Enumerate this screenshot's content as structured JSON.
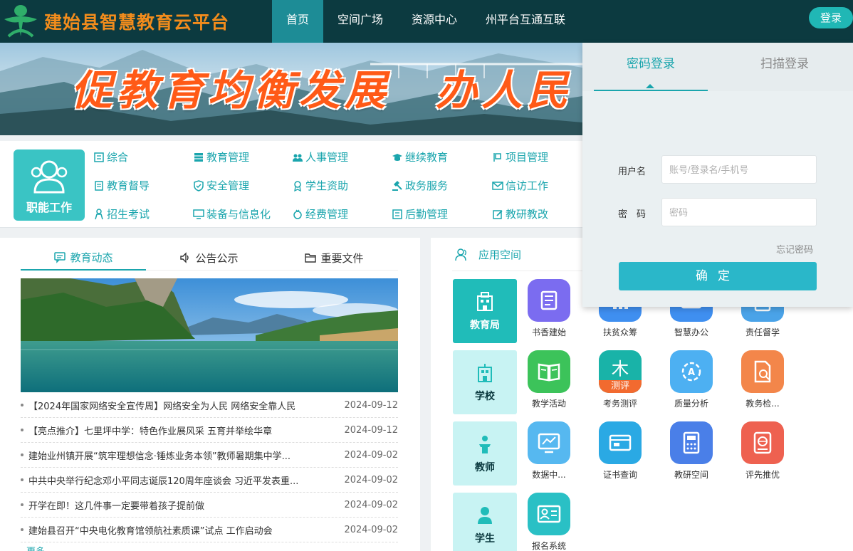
{
  "header": {
    "site_title": "建始县智慧教育云平台",
    "nav": [
      "首页",
      "空间广场",
      "资源中心",
      "州平台互通互联"
    ],
    "active_nav": 0,
    "login_label": "登录"
  },
  "banner": {
    "slogan": "促教育均衡发展　办人民"
  },
  "functions": {
    "card_label": "职能工作",
    "items": [
      {
        "label": "综合",
        "icon": "list-icon"
      },
      {
        "label": "教育管理",
        "icon": "table-icon"
      },
      {
        "label": "人事管理",
        "icon": "users-icon"
      },
      {
        "label": "继续教育",
        "icon": "graduation-cap-icon"
      },
      {
        "label": "项目管理",
        "icon": "flag-icon"
      },
      {
        "label": "教育督导",
        "icon": "clipboard-icon"
      },
      {
        "label": "安全管理",
        "icon": "shield-icon"
      },
      {
        "label": "学生资助",
        "icon": "award-icon"
      },
      {
        "label": "政务服务",
        "icon": "gavel-icon"
      },
      {
        "label": "信访工作",
        "icon": "mail-icon"
      },
      {
        "label": "招生考试",
        "icon": "person-icon"
      },
      {
        "label": "装备与信息化",
        "icon": "monitor-icon"
      },
      {
        "label": "经费管理",
        "icon": "coins-icon"
      },
      {
        "label": "后勤管理",
        "icon": "list-icon"
      },
      {
        "label": "教研教改",
        "icon": "edit-icon"
      }
    ]
  },
  "news": {
    "tabs": [
      "教育动态",
      "公告公示",
      "重要文件"
    ],
    "active_tab": 0,
    "items": [
      {
        "title": "【2024年国家网络安全宣传周】网络安全为人民 网络安全靠人民",
        "date": "2024-09-12"
      },
      {
        "title": "【亮点推介】七里坪中学：特色作业展风采 五育并举绘华章",
        "date": "2024-09-12"
      },
      {
        "title": "建始业州镇开展“筑牢理想信念·锤炼业务本领”教师暑期集中学...",
        "date": "2024-09-02"
      },
      {
        "title": "中共中央举行纪念邓小平同志诞辰120周年座谈会 习近平发表重...",
        "date": "2024-09-02"
      },
      {
        "title": "开学在即！这几件事一定要带着孩子提前做",
        "date": "2024-09-02"
      },
      {
        "title": "建始县召开“中央电化教育馆领航社素质课”试点 工作启动会",
        "date": "2024-09-02"
      }
    ],
    "more_label": "更多"
  },
  "apps": {
    "title": "应用空间",
    "roles": [
      {
        "label": "教育局",
        "active": true
      },
      {
        "label": "学校",
        "active": false
      },
      {
        "label": "教师",
        "active": false
      },
      {
        "label": "学生",
        "active": false
      }
    ],
    "items": [
      {
        "label": "书香建始",
        "color": "#7b6cf0",
        "icon": "book-icon"
      },
      {
        "label": "扶贫众筹",
        "color": "#3f8ff0",
        "icon": "chart-icon"
      },
      {
        "label": "智慧办公",
        "color": "#3f8ff0",
        "icon": "office-icon"
      },
      {
        "label": "责任督学",
        "color": "#4aa3e8",
        "icon": "document-icon"
      },
      {
        "label": "教学活动",
        "color": "#3cc35a",
        "icon": "open-book-icon"
      },
      {
        "label": "考务测评",
        "color": "#19b3a8",
        "icon": "exam-icon"
      },
      {
        "label": "质量分析",
        "color": "#4db0f2",
        "icon": "analysis-icon"
      },
      {
        "label": "教务检...",
        "color": "#f3864a",
        "icon": "file-search-icon"
      },
      {
        "label": "数据中...",
        "color": "#56b8f0",
        "icon": "data-screen-icon"
      },
      {
        "label": "证书查询",
        "color": "#2aa9e4",
        "icon": "certificate-icon"
      },
      {
        "label": "教研空间",
        "color": "#4a7fe8",
        "icon": "calculator-icon"
      },
      {
        "label": "评先推优",
        "color": "#ee6150",
        "icon": "globe-icon"
      },
      {
        "label": "报名系统",
        "color": "#2ac0c5",
        "icon": "id-card-icon"
      }
    ],
    "exam_badge": "测评"
  },
  "login": {
    "tabs": [
      "密码登录",
      "扫描登录"
    ],
    "username_label": "用户名",
    "username_placeholder": "账号/登录名/手机号",
    "password_label": "密　码",
    "password_placeholder": "密码",
    "forgot": "忘记密码",
    "submit": "确定"
  },
  "colors": {
    "topbar": "#0c3a40",
    "accent": "#1aa5ad",
    "login_button": "#2ab7c9"
  }
}
